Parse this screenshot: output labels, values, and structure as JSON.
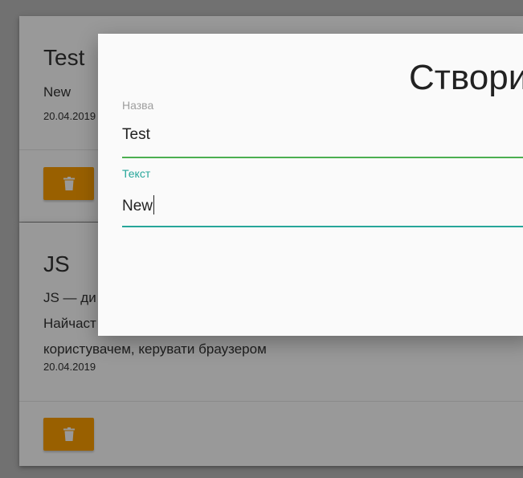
{
  "cards": [
    {
      "title": "Test",
      "text": "New",
      "date": "20.04.2019"
    },
    {
      "title": "JS",
      "text": "JS — ди Найчаст коритувачем, керувати браузером",
      "text_lines": [
        "JS — ди",
        "Найчаст",
        "користувачем, керувати браузером"
      ],
      "date": "20.04.2019"
    }
  ],
  "colors": {
    "accent": "#26a69a",
    "valid": "#4caf50",
    "delete": "#ffa000"
  },
  "icons": {
    "delete": "trash-icon"
  },
  "modal": {
    "title": "Створи",
    "name_label": "Назва",
    "name_value": "Test",
    "text_label": "Текст",
    "text_value": "New"
  }
}
